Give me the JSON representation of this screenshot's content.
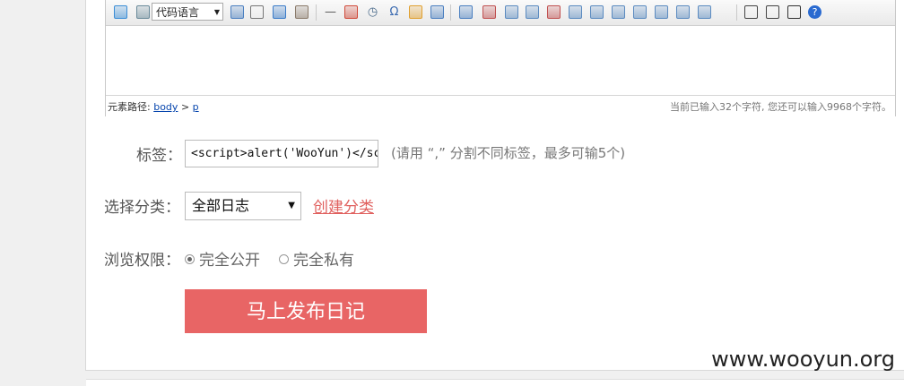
{
  "toolbar": {
    "code_language": "代码语言",
    "icons": [
      {
        "name": "image-icon",
        "color": "#3a8dd6"
      },
      {
        "name": "document-icon",
        "color": "#6a8a9a"
      },
      {
        "name": "flash-icon",
        "color": "#4a7fc0"
      },
      {
        "name": "page-break-icon",
        "color": "#777"
      },
      {
        "name": "template-icon",
        "color": "#3a7bc8"
      },
      {
        "name": "media-icon",
        "color": "#8a7a6a"
      },
      {
        "name": "horizontal-rule-icon",
        "color": "#555"
      },
      {
        "name": "calendar-icon",
        "color": "#d04a3a"
      },
      {
        "name": "clock-icon",
        "color": "#4a6a8a"
      },
      {
        "name": "special-char-icon",
        "color": "#3a6ab0"
      },
      {
        "name": "emoticon-icon",
        "color": "#e0a030"
      },
      {
        "name": "paste-word-icon",
        "color": "#4a7fc0"
      },
      {
        "name": "table-icon",
        "color": "#4a7fc0"
      },
      {
        "name": "table-props-icon",
        "color": "#c05050"
      },
      {
        "name": "cell-props-icon",
        "color": "#5a8ac0"
      },
      {
        "name": "insert-row-icon",
        "color": "#5a8ac0"
      },
      {
        "name": "insert-col-icon",
        "color": "#c05050"
      },
      {
        "name": "delete-row-icon",
        "color": "#5a8ac0"
      },
      {
        "name": "delete-col-icon",
        "color": "#5a8ac0"
      },
      {
        "name": "merge-cells-icon",
        "color": "#5a8ac0"
      },
      {
        "name": "split-cells-icon",
        "color": "#5a8ac0"
      },
      {
        "name": "split-row-icon",
        "color": "#5a8ac0"
      },
      {
        "name": "split-col-icon",
        "color": "#5a8ac0"
      },
      {
        "name": "delete-table-icon",
        "color": "#5a8ac0"
      },
      {
        "name": "print-icon",
        "color": "#444"
      },
      {
        "name": "preview-icon",
        "color": "#444"
      },
      {
        "name": "search-replace-icon",
        "color": "#333"
      },
      {
        "name": "help-icon",
        "color": "#2a6ad0"
      }
    ]
  },
  "status": {
    "path_label": "元素路径:",
    "path_body": "body",
    "path_sep": ">",
    "path_p": "p",
    "char_count": "当前已输入32个字符, 您还可以输入9968个字符。"
  },
  "form": {
    "tags_label": "标签：",
    "tags_value": "<script>alert('WooYun')</scrip",
    "tags_hint": "(请用 “,” 分割不同标签，最多可输5个)",
    "category_label": "选择分类：",
    "category_value": "全部日志",
    "create_category": "创建分类",
    "privacy_label": "浏览权限：",
    "privacy_public": "完全公开",
    "privacy_private": "完全私有",
    "privacy_selected": "public",
    "publish_button": "马上发布日记"
  },
  "watermark": "www.wooyun.org"
}
